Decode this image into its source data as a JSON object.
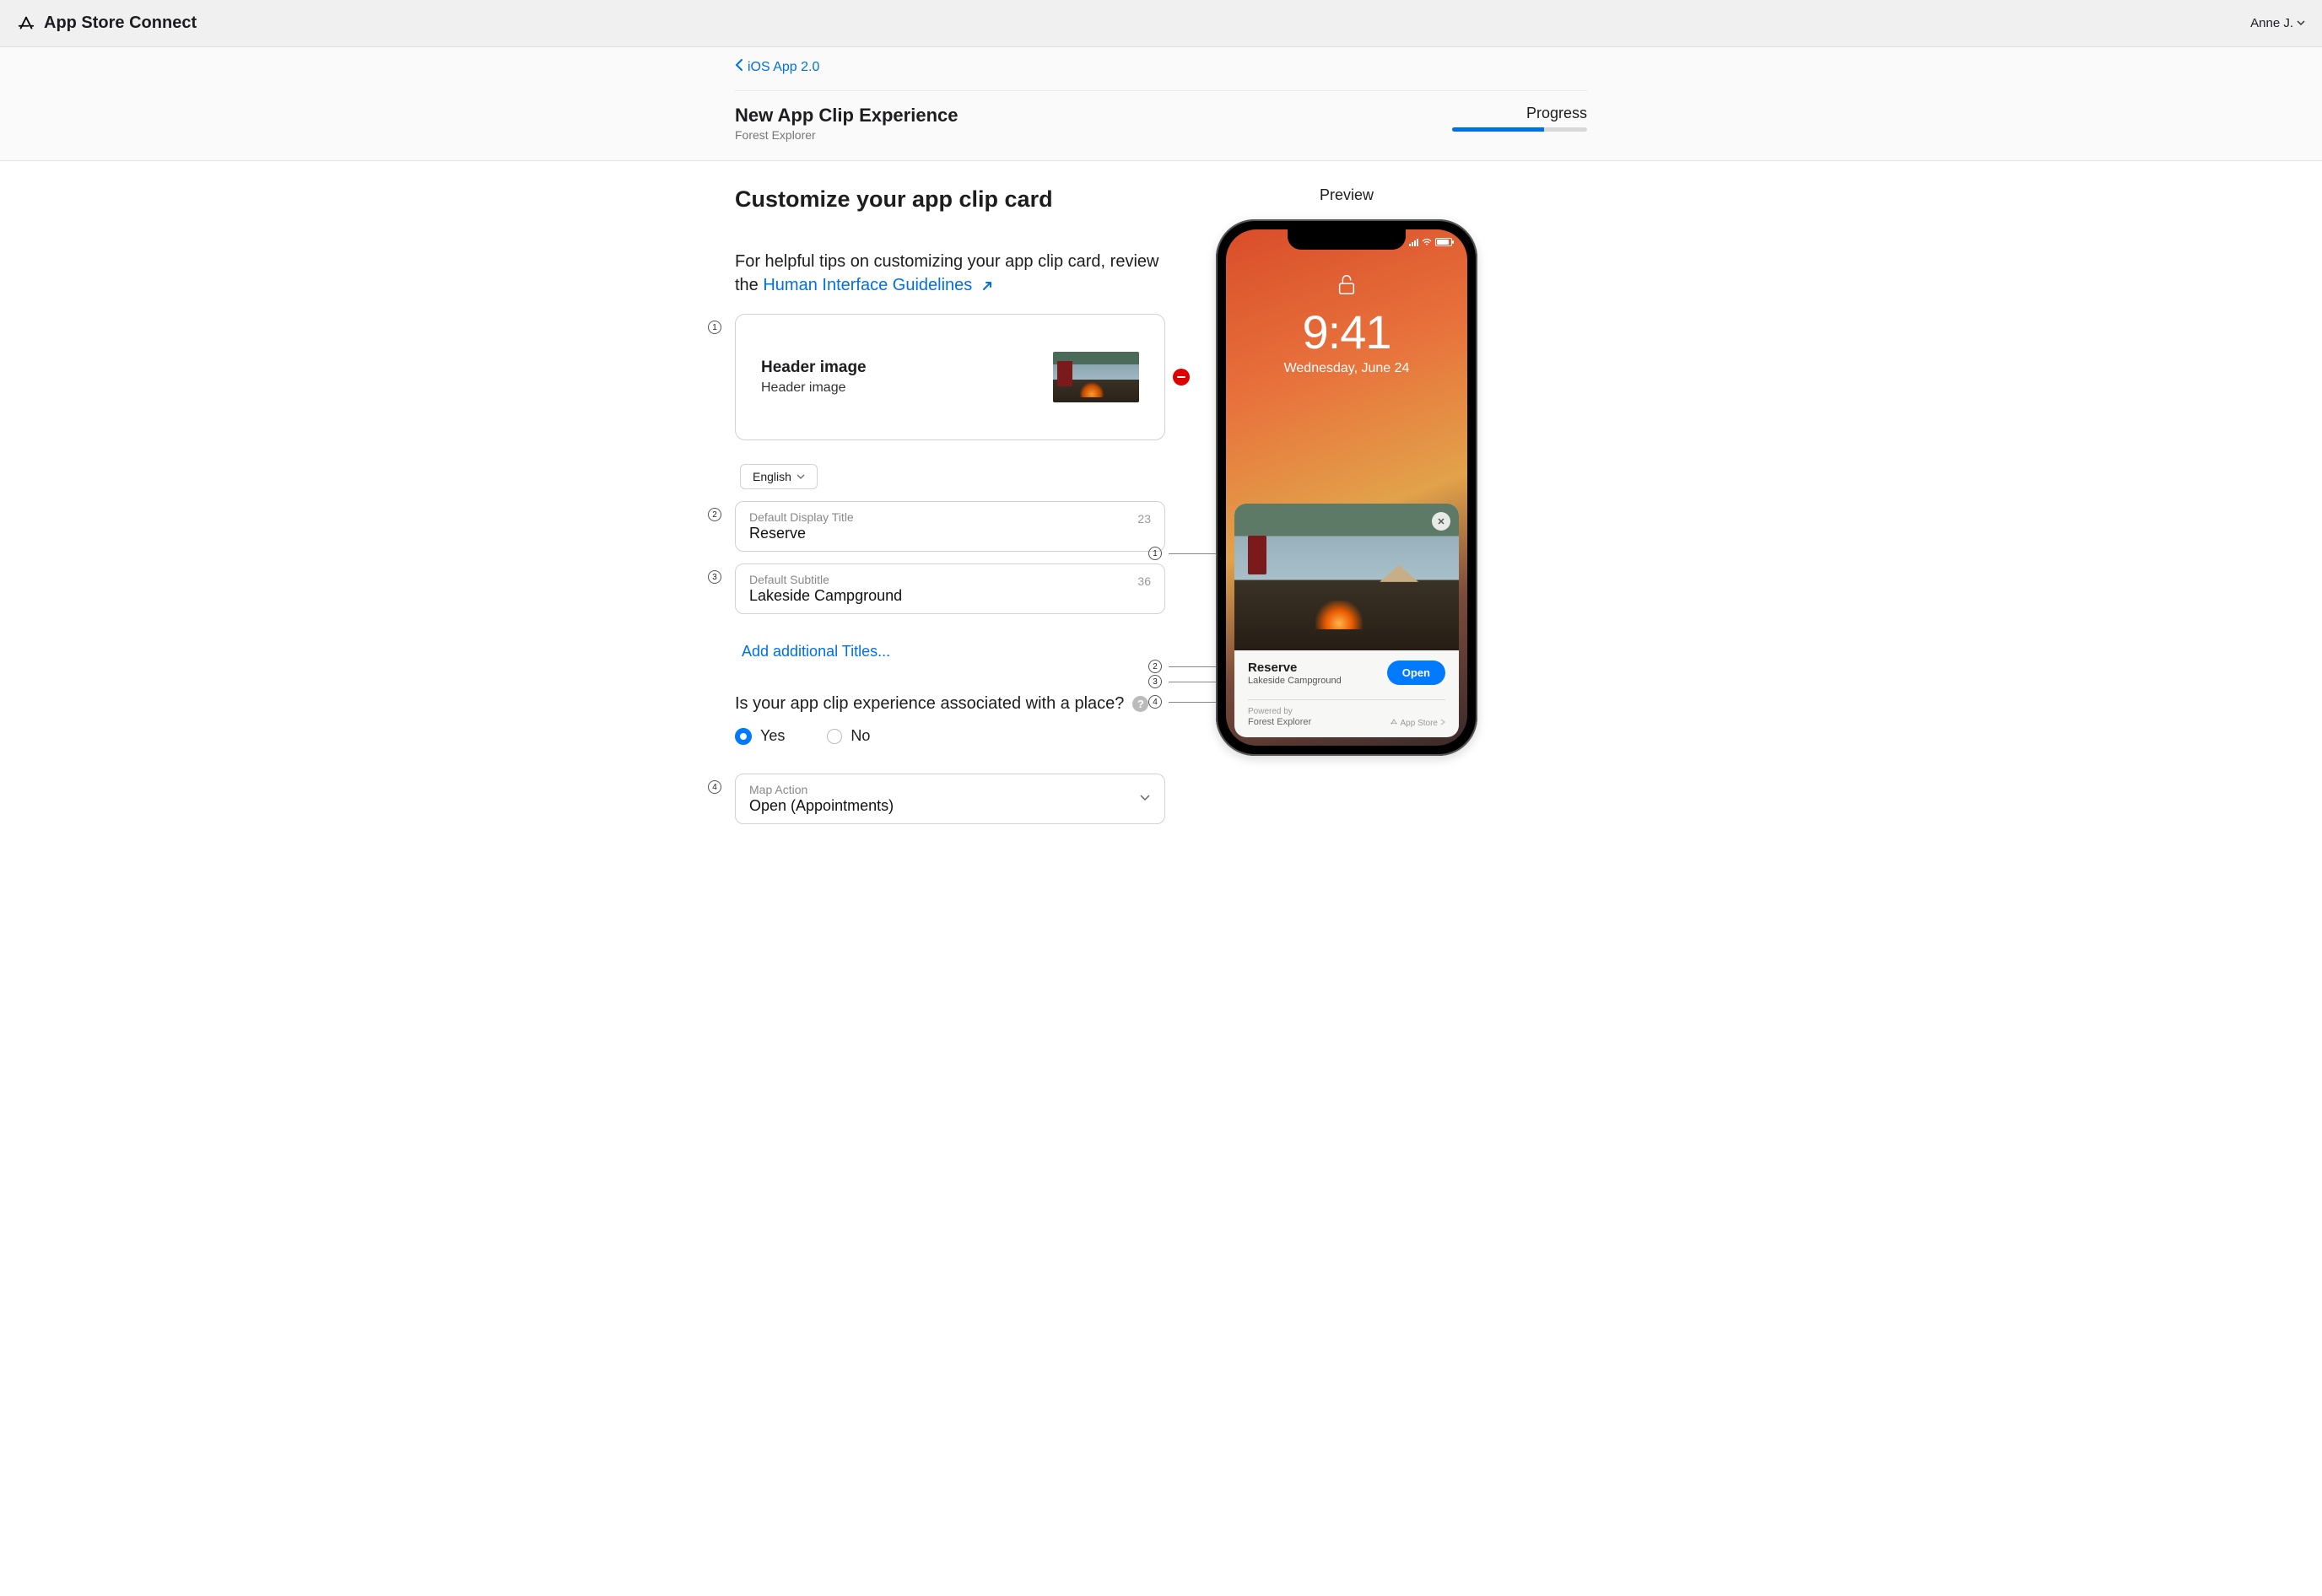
{
  "topbar": {
    "title": "App Store Connect",
    "user": "Anne J."
  },
  "breadcrumb": {
    "label": "iOS App 2.0"
  },
  "header": {
    "title": "New App Clip Experience",
    "subtitle": "Forest Explorer",
    "progress_label": "Progress",
    "progress_percent": 68
  },
  "form": {
    "heading": "Customize your app clip card",
    "intro_prefix": "For helpful tips on customizing your app clip card, review the ",
    "intro_link": "Human Interface Guidelines",
    "header_image": {
      "title": "Header image",
      "subtitle": "Header image"
    },
    "language": "English",
    "title_field": {
      "label": "Default Display Title",
      "value": "Reserve",
      "remaining": "23"
    },
    "subtitle_field": {
      "label": "Default Subtitle",
      "value": "Lakeside Campground",
      "remaining": "36"
    },
    "add_titles": "Add additional Titles...",
    "place_question": "Is your app clip experience associated with a place?",
    "yes_label": "Yes",
    "no_label": "No",
    "place_selected": "yes",
    "map_action": {
      "label": "Map Action",
      "value": "Open (Appointments)"
    }
  },
  "preview": {
    "label": "Preview",
    "time": "9:41",
    "date": "Wednesday, June 24",
    "clip_title": "Reserve",
    "clip_subtitle": "Lakeside Campground",
    "clip_button": "Open",
    "powered_by": "Powered by",
    "app_name": "Forest Explorer",
    "store_label": "App Store"
  }
}
